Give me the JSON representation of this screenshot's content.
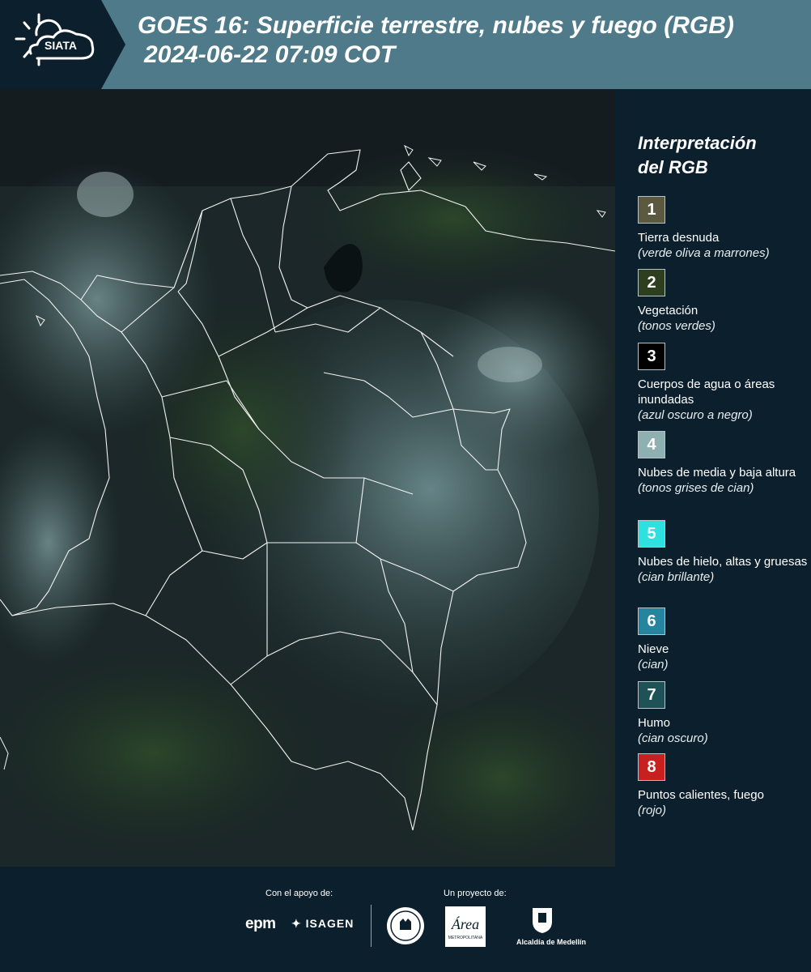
{
  "header": {
    "logo_text": "SIATA",
    "title_line1": "GOES 16: Superficie terrestre, nubes y fuego (RGB)",
    "title_line2": "2024-06-22 07:09 COT"
  },
  "legend": {
    "title_line1": "Interpretación",
    "title_line2": "del RGB",
    "items": [
      {
        "num": "1",
        "color": "#5b5a40",
        "label": "Tierra desnuda",
        "sub": "(verde oliva a marrones)"
      },
      {
        "num": "2",
        "color": "#2e3f1f",
        "label": "Vegetación",
        "sub": "(tonos verdes)"
      },
      {
        "num": "3",
        "color": "#000000",
        "label": "Cuerpos de agua o áreas inundadas",
        "sub": "(azul oscuro a negro)"
      },
      {
        "num": "4",
        "color": "#8fb0b0",
        "label": "Nubes de media y baja altura",
        "sub": "(tonos grises de cian)"
      },
      {
        "num": "5",
        "color": "#2ee0e0",
        "label": "Nubes de hielo, altas y gruesas",
        "sub": "(cian brillante)"
      },
      {
        "num": "6",
        "color": "#25859e",
        "label": "Nieve",
        "sub": "(cian)"
      },
      {
        "num": "7",
        "color": "#1e5256",
        "label": "Humo",
        "sub": "(cian oscuro)"
      },
      {
        "num": "8",
        "color": "#c8201f",
        "label": "Puntos calientes, fuego",
        "sub": "(rojo)"
      }
    ]
  },
  "footer": {
    "support_label": "Con el apoyo de:",
    "project_label": "Un proyecto de:",
    "epm": "epm",
    "isagen": "ISAGEN",
    "amva_text": "METROPOLITANA",
    "alcaldia": "Alcaldía de Medellín"
  }
}
